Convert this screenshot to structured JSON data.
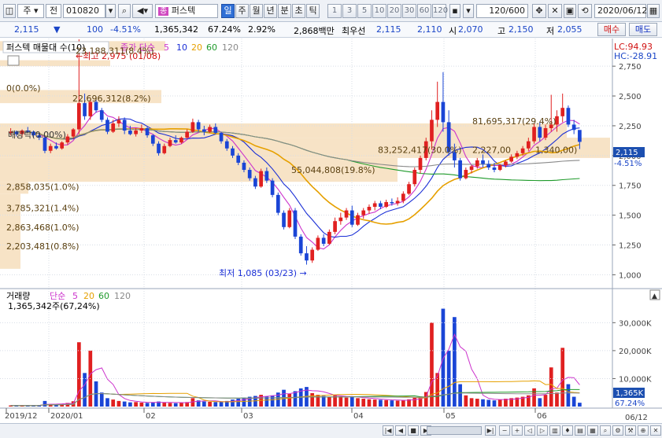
{
  "toolbar": {
    "code_type": "주",
    "market_type": "전",
    "stock_code": "010820",
    "stock_name_badge": "종",
    "stock_name": "퍼스텍",
    "periods": [
      "일",
      "주",
      "월",
      "년",
      "분",
      "초",
      "틱"
    ],
    "selected_period": "일",
    "intervals": [
      "1",
      "3",
      "5",
      "10",
      "20",
      "30",
      "60",
      "120"
    ],
    "count_display": "120/600",
    "date": "2020/06/12"
  },
  "infobar": {
    "price": "2,115",
    "change": "100",
    "change_pct": "-4.51%",
    "volume": "1,365,342",
    "volume_ratio": "67.24%",
    "turnover": "2.92%",
    "amount": "2,868백만",
    "best_ask_label": "최우선",
    "best_ask": "2,115",
    "best_bid": "2,110",
    "open_label": "시",
    "open": "2,070",
    "high_label": "고",
    "high": "2,150",
    "low_label": "저",
    "low": "2,055",
    "buy_button": "매수",
    "sell_button": "매도"
  },
  "price_panel": {
    "legend_name": "퍼스텍 매물대 수(10)",
    "legend_ma": "종가 단순",
    "ma_periods": [
      "5",
      "10",
      "20",
      "60",
      "120"
    ],
    "lc": "LC:94.93",
    "hc": "HC:-28.91",
    "high_note": "←최고 2,975 (01/08)",
    "low_note": "최저 1,085 (03/23) →",
    "price_tag": "2,115",
    "pct_tag": "-4.51%",
    "dividend_label": "배당락(0.00%)",
    "zero_label": "0(0.0%)",
    "vp_labels": [
      "23,188,311(8.4%)",
      "22,696,312(8.2%)",
      "81,695,317(29.4%)",
      "83,252,417(30.0%)",
      "2,227,00",
      "1,340,00)",
      "55,044,808(19.8%)",
      "2,858,035(1.0%)",
      "3,785,321(1.4%)",
      "2,863,468(1.0%)",
      "2,203,481(0.8%)"
    ],
    "y_ticks": [
      "2,750",
      "2,500",
      "2,250",
      "2,000",
      "1,750",
      "1,500",
      "1,250",
      "1,000"
    ]
  },
  "volume_panel": {
    "legend_name": "거래량",
    "legend_ma": "단순",
    "ma_periods": [
      "5",
      "20",
      "60",
      "120"
    ],
    "current_label": "1,365,342주(67,24%)",
    "volume_tag": "1,365K",
    "ratio_tag": "67.24%",
    "y_ticks": [
      "30,000K",
      "20,000K",
      "10,000K"
    ]
  },
  "date_axis": {
    "labels": [
      "2019/12",
      "2020/01",
      "02",
      "03",
      "04",
      "05",
      "06"
    ],
    "current": "06/12"
  },
  "colors": {
    "up": "#e02020",
    "down": "#1a45d6",
    "ma5": "#cc33cc",
    "ma10": "#1a2fd6",
    "ma20": "#e6a000",
    "ma60": "#1e9a2a",
    "ma120": "#8a8a8a",
    "volume_profile": "#f7e3c6",
    "price_tag_bg": "#1c4fb0"
  },
  "chart_data": {
    "type": "candlestick",
    "y_range": [
      950,
      2850
    ],
    "candles": [
      [
        2190,
        2230,
        2170,
        2200
      ],
      [
        2200,
        2210,
        2160,
        2180
      ],
      [
        2180,
        2220,
        2160,
        2210
      ],
      [
        2210,
        2240,
        2190,
        2200
      ],
      [
        2200,
        2210,
        2150,
        2170
      ],
      [
        2170,
        2190,
        2130,
        2150
      ],
      [
        2150,
        2160,
        2020,
        2040
      ],
      [
        2040,
        2100,
        2020,
        2080
      ],
      [
        2080,
        2110,
        2050,
        2060
      ],
      [
        2060,
        2120,
        2050,
        2110
      ],
      [
        2110,
        2180,
        2090,
        2160
      ],
      [
        2160,
        2230,
        2140,
        2220
      ],
      [
        2220,
        2975,
        2180,
        2440
      ],
      [
        2440,
        2520,
        2300,
        2330
      ],
      [
        2330,
        2470,
        2300,
        2450
      ],
      [
        2450,
        2470,
        2360,
        2380
      ],
      [
        2380,
        2400,
        2280,
        2300
      ],
      [
        2300,
        2320,
        2180,
        2200
      ],
      [
        2200,
        2300,
        2190,
        2270
      ],
      [
        2270,
        2330,
        2240,
        2300
      ],
      [
        2300,
        2320,
        2180,
        2210
      ],
      [
        2210,
        2250,
        2170,
        2180
      ],
      [
        2180,
        2230,
        2160,
        2210
      ],
      [
        2210,
        2260,
        2190,
        2230
      ],
      [
        2230,
        2240,
        2150,
        2170
      ],
      [
        2170,
        2180,
        2080,
        2100
      ],
      [
        2100,
        2120,
        2000,
        2020
      ],
      [
        2020,
        2100,
        2010,
        2080
      ],
      [
        2080,
        2150,
        2070,
        2130
      ],
      [
        2130,
        2170,
        2100,
        2110
      ],
      [
        2110,
        2160,
        2100,
        2150
      ],
      [
        2150,
        2220,
        2140,
        2200
      ],
      [
        2200,
        2310,
        2190,
        2280
      ],
      [
        2280,
        2300,
        2200,
        2220
      ],
      [
        2220,
        2250,
        2170,
        2200
      ],
      [
        2200,
        2260,
        2190,
        2240
      ],
      [
        2240,
        2270,
        2180,
        2190
      ],
      [
        2190,
        2200,
        2100,
        2120
      ],
      [
        2120,
        2140,
        2040,
        2060
      ],
      [
        2060,
        2080,
        1980,
        2000
      ],
      [
        2000,
        2020,
        1920,
        1940
      ],
      [
        1940,
        1960,
        1860,
        1880
      ],
      [
        1880,
        1900,
        1790,
        1810
      ],
      [
        1810,
        1830,
        1720,
        1740
      ],
      [
        1740,
        1890,
        1730,
        1870
      ],
      [
        1870,
        1900,
        1770,
        1790
      ],
      [
        1790,
        1810,
        1650,
        1670
      ],
      [
        1670,
        1690,
        1500,
        1520
      ],
      [
        1520,
        1540,
        1380,
        1400
      ],
      [
        1400,
        1560,
        1390,
        1540
      ],
      [
        1540,
        1560,
        1300,
        1320
      ],
      [
        1320,
        1340,
        1160,
        1180
      ],
      [
        1180,
        1240,
        1085,
        1120
      ],
      [
        1120,
        1230,
        1100,
        1210
      ],
      [
        1210,
        1330,
        1200,
        1310
      ],
      [
        1310,
        1340,
        1240,
        1260
      ],
      [
        1260,
        1380,
        1250,
        1360
      ],
      [
        1360,
        1480,
        1340,
        1450
      ],
      [
        1450,
        1520,
        1420,
        1480
      ],
      [
        1480,
        1560,
        1460,
        1540
      ],
      [
        1540,
        1580,
        1400,
        1420
      ],
      [
        1420,
        1520,
        1410,
        1500
      ],
      [
        1500,
        1560,
        1470,
        1540
      ],
      [
        1540,
        1590,
        1510,
        1570
      ],
      [
        1570,
        1620,
        1540,
        1600
      ],
      [
        1600,
        1620,
        1550,
        1570
      ],
      [
        1570,
        1630,
        1560,
        1610
      ],
      [
        1610,
        1640,
        1580,
        1600
      ],
      [
        1600,
        1650,
        1580,
        1620
      ],
      [
        1620,
        1700,
        1600,
        1680
      ],
      [
        1680,
        1780,
        1670,
        1760
      ],
      [
        1760,
        1900,
        1740,
        1880
      ],
      [
        1880,
        2000,
        1850,
        1980
      ],
      [
        1980,
        2150,
        1960,
        2120
      ],
      [
        2120,
        2380,
        2050,
        2300
      ],
      [
        2300,
        2620,
        2240,
        2450
      ],
      [
        2450,
        2700,
        2200,
        2280
      ],
      [
        2280,
        2380,
        2000,
        2030
      ],
      [
        2030,
        2100,
        1900,
        1960
      ],
      [
        1960,
        1980,
        1790,
        1810
      ],
      [
        1810,
        1900,
        1800,
        1880
      ],
      [
        1880,
        1920,
        1850,
        1910
      ],
      [
        1910,
        1980,
        1890,
        1960
      ],
      [
        1960,
        2010,
        1900,
        1930
      ],
      [
        1930,
        1960,
        1880,
        1900
      ],
      [
        1900,
        1940,
        1860,
        1880
      ],
      [
        1880,
        1930,
        1870,
        1920
      ],
      [
        1920,
        1960,
        1900,
        1950
      ],
      [
        1950,
        2010,
        1940,
        1990
      ],
      [
        1990,
        2040,
        1970,
        2020
      ],
      [
        2020,
        2080,
        2000,
        2060
      ],
      [
        2060,
        2150,
        2040,
        2120
      ],
      [
        2120,
        2270,
        2100,
        2240
      ],
      [
        2240,
        2280,
        2120,
        2150
      ],
      [
        2150,
        2260,
        2130,
        2230
      ],
      [
        2230,
        2510,
        2200,
        2260
      ],
      [
        2260,
        2380,
        2200,
        2330
      ],
      [
        2330,
        2520,
        2280,
        2400
      ],
      [
        2400,
        2420,
        2240,
        2260
      ],
      [
        2260,
        2300,
        2180,
        2215
      ],
      [
        2215,
        2150,
        2055,
        2115
      ]
    ],
    "volume_k": [
      400,
      300,
      350,
      420,
      380,
      500,
      2000,
      900,
      600,
      800,
      1300,
      1900,
      23000,
      12000,
      20000,
      9000,
      5000,
      3000,
      2500,
      2000,
      1800,
      1500,
      1600,
      1400,
      1300,
      1500,
      1800,
      1400,
      1300,
      1200,
      1400,
      1600,
      3000,
      2200,
      1800,
      1700,
      1600,
      1700,
      2000,
      2500,
      2800,
      3200,
      3500,
      3800,
      4200,
      3600,
      4000,
      5000,
      6000,
      4500,
      5500,
      6500,
      7000,
      4800,
      4200,
      3800,
      3500,
      4000,
      3600,
      3200,
      3500,
      3000,
      2800,
      2600,
      2500,
      2400,
      2300,
      2200,
      2100,
      2200,
      2600,
      3200,
      3600,
      5200,
      30000,
      12000,
      35000,
      20000,
      32000,
      8000,
      4000,
      3000,
      2800,
      2600,
      2400,
      2200,
      2500,
      2800,
      3000,
      3200,
      3500,
      4000,
      6500,
      3000,
      4200,
      14000,
      5000,
      21000,
      8000,
      3500,
      1365
    ]
  }
}
